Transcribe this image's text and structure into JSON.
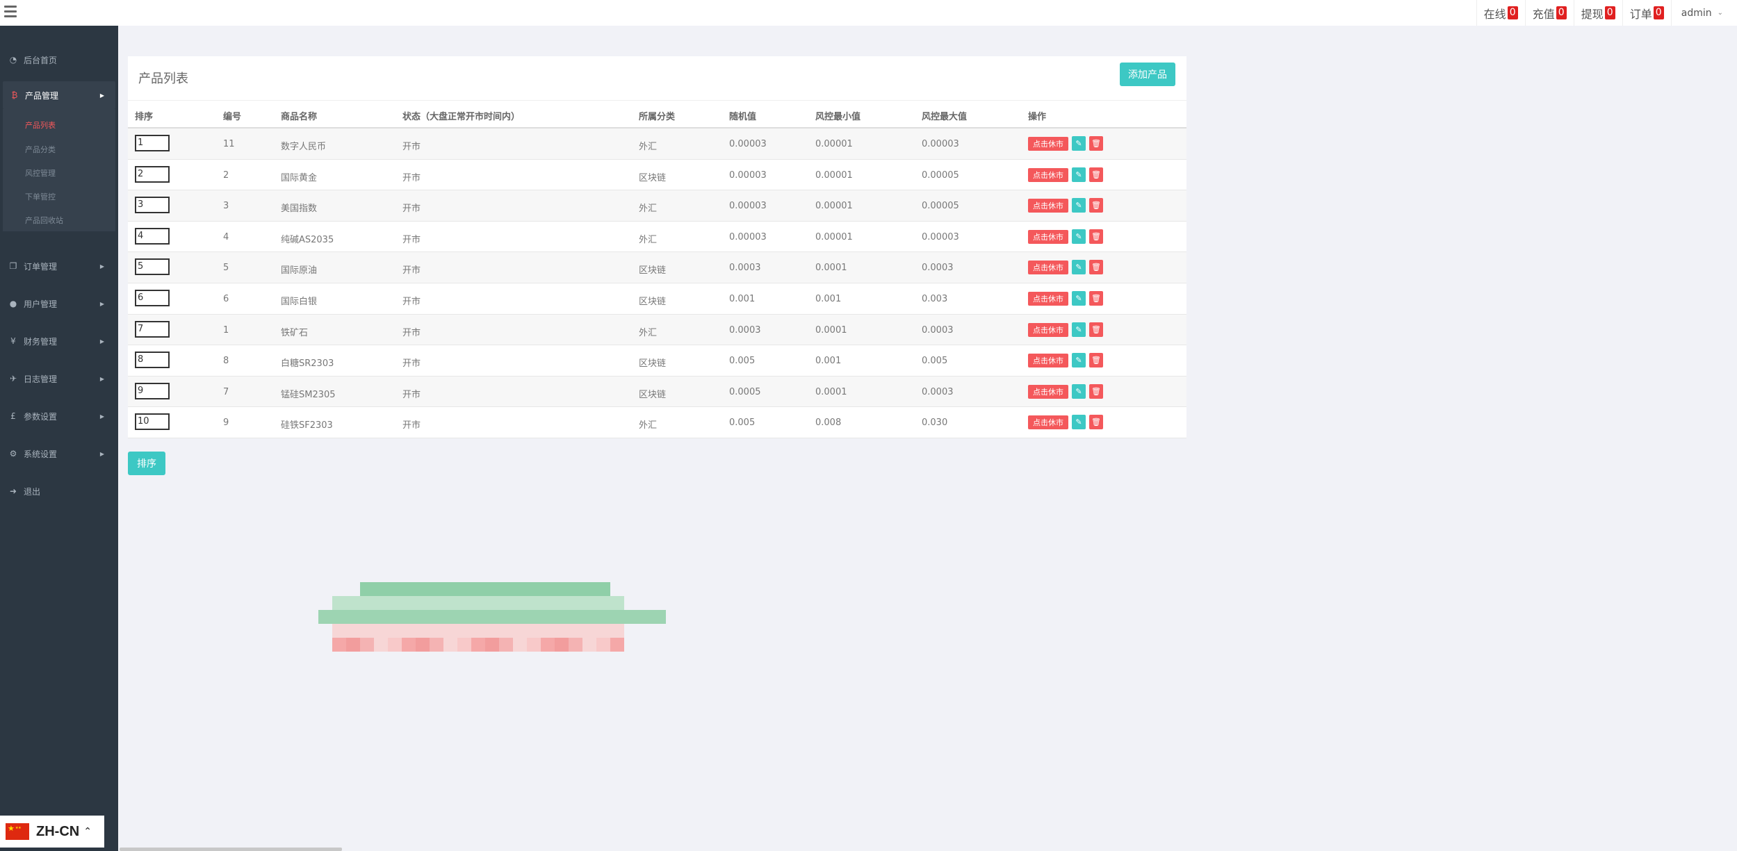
{
  "topbar": {
    "stats": [
      {
        "label": "在线",
        "count": "0"
      },
      {
        "label": "充值",
        "count": "0"
      },
      {
        "label": "提现",
        "count": "0"
      },
      {
        "label": "订单",
        "count": "0"
      }
    ],
    "user": "admin"
  },
  "sidebar": {
    "items": [
      {
        "label": "后台首页",
        "icon": "dashboard-icon"
      },
      {
        "label": "产品管理",
        "icon": "bitcoin-icon"
      },
      {
        "label": "订单管理",
        "icon": "copy-icon"
      },
      {
        "label": "用户管理",
        "icon": "user-icon"
      },
      {
        "label": "财务管理",
        "icon": "yen-icon"
      },
      {
        "label": "日志管理",
        "icon": "rocket-icon"
      },
      {
        "label": "参数设置",
        "icon": "pound-icon"
      },
      {
        "label": "系统设置",
        "icon": "cogs-icon"
      },
      {
        "label": "退出",
        "icon": "sign-out-icon"
      }
    ],
    "subitems": [
      "产品列表",
      "产品分类",
      "风控管理",
      "下单管控",
      "产品回收站"
    ]
  },
  "language": {
    "code": "ZH-CN",
    "flag": "china-flag-icon"
  },
  "panel": {
    "title": "产品列表",
    "add_label": "添加产品",
    "sort_label": "排序"
  },
  "table": {
    "headers": [
      "排序",
      "编号",
      "商品名称",
      "状态（大盘正常开市时间内）",
      "所属分类",
      "随机值",
      "风控最小值",
      "风控最大值",
      "操作"
    ],
    "action_label": "点击休市",
    "rows": [
      {
        "sort": "1",
        "id": "11",
        "name": "数字人民币",
        "status": "开市",
        "category": "外汇",
        "random": "0.00003",
        "min": "0.00001",
        "max": "0.00003"
      },
      {
        "sort": "2",
        "id": "2",
        "name": "国际黄金",
        "status": "开市",
        "category": "区块链",
        "random": "0.00003",
        "min": "0.00001",
        "max": "0.00005"
      },
      {
        "sort": "3",
        "id": "3",
        "name": "美国指数",
        "status": "开市",
        "category": "外汇",
        "random": "0.00003",
        "min": "0.00001",
        "max": "0.00005"
      },
      {
        "sort": "4",
        "id": "4",
        "name": "纯碱AS2035",
        "status": "开市",
        "category": "外汇",
        "random": "0.00003",
        "min": "0.00001",
        "max": "0.00003"
      },
      {
        "sort": "5",
        "id": "5",
        "name": "国际原油",
        "status": "开市",
        "category": "区块链",
        "random": "0.0003",
        "min": "0.0001",
        "max": "0.0003"
      },
      {
        "sort": "6",
        "id": "6",
        "name": "国际白银",
        "status": "开市",
        "category": "区块链",
        "random": "0.001",
        "min": "0.001",
        "max": "0.003"
      },
      {
        "sort": "7",
        "id": "1",
        "name": "铁矿石",
        "status": "开市",
        "category": "外汇",
        "random": "0.0003",
        "min": "0.0001",
        "max": "0.0003"
      },
      {
        "sort": "8",
        "id": "8",
        "name": "白糖SR2303",
        "status": "开市",
        "category": "区块链",
        "random": "0.005",
        "min": "0.001",
        "max": "0.005"
      },
      {
        "sort": "9",
        "id": "7",
        "name": "锰硅SM2305",
        "status": "开市",
        "category": "区块链",
        "random": "0.0005",
        "min": "0.0001",
        "max": "0.0003"
      },
      {
        "sort": "10",
        "id": "9",
        "name": "硅铁SF2303",
        "status": "开市",
        "category": "外汇",
        "random": "0.005",
        "min": "0.008",
        "max": "0.030"
      }
    ]
  },
  "colors": {
    "accent": "#3dc8c4",
    "danger": "#f4585b",
    "sidebar": "#2c3742",
    "badge": "#e02020"
  }
}
